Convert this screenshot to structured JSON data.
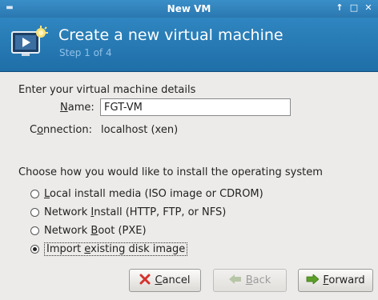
{
  "window": {
    "title": "New VM"
  },
  "header": {
    "title": "Create a new virtual machine",
    "step": "Step 1 of 4"
  },
  "details": {
    "heading": "Enter your virtual machine details",
    "name_label_pre": "",
    "name_label_u": "N",
    "name_label_post": "ame:",
    "name_value": "FGT-VM",
    "connection_label_pre": "C",
    "connection_label_u": "o",
    "connection_label_post": "nnection:",
    "connection_value": "localhost (xen)"
  },
  "install": {
    "heading": "Choose how you would like to install the operating system",
    "options": [
      {
        "pre": "",
        "u": "L",
        "post": "ocal install media (ISO image or CDROM)",
        "checked": false
      },
      {
        "pre": "Network ",
        "u": "I",
        "post": "nstall (HTTP, FTP, or NFS)",
        "checked": false
      },
      {
        "pre": "Network ",
        "u": "B",
        "post": "oot (PXE)",
        "checked": false
      },
      {
        "pre": "Import ",
        "u": "e",
        "post": "xisting disk image",
        "checked": true
      }
    ]
  },
  "buttons": {
    "cancel": {
      "u": "C",
      "post": "ancel"
    },
    "back": {
      "u": "B",
      "post": "ack",
      "disabled": true
    },
    "forward": {
      "u": "F",
      "post": "orward"
    }
  },
  "colors": {
    "header_bg": "#2a7ab5",
    "step_text": "#8fc1e8"
  }
}
